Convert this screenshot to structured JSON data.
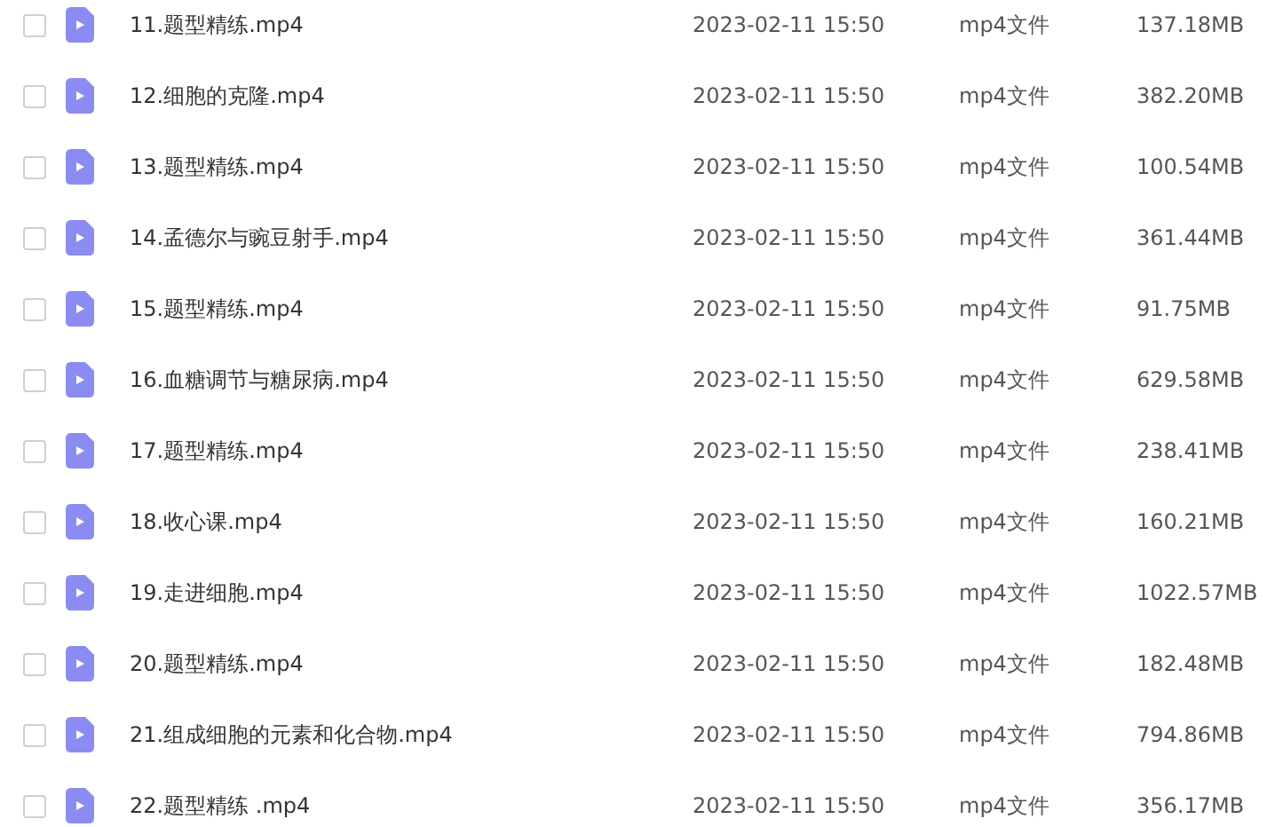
{
  "files": [
    {
      "name": "11.题型精练.mp4",
      "date": "2023-02-11 15:50",
      "type": "mp4文件",
      "size": "137.18MB",
      "checked": false
    },
    {
      "name": "12.细胞的克隆.mp4",
      "date": "2023-02-11 15:50",
      "type": "mp4文件",
      "size": "382.20MB",
      "checked": false
    },
    {
      "name": "13.题型精练.mp4",
      "date": "2023-02-11 15:50",
      "type": "mp4文件",
      "size": "100.54MB",
      "checked": false
    },
    {
      "name": "14.孟德尔与豌豆射手.mp4",
      "date": "2023-02-11 15:50",
      "type": "mp4文件",
      "size": "361.44MB",
      "checked": false
    },
    {
      "name": "15.题型精练.mp4",
      "date": "2023-02-11 15:50",
      "type": "mp4文件",
      "size": "91.75MB",
      "checked": false
    },
    {
      "name": "16.血糖调节与糖尿病.mp4",
      "date": "2023-02-11 15:50",
      "type": "mp4文件",
      "size": "629.58MB",
      "checked": false
    },
    {
      "name": "17.题型精练.mp4",
      "date": "2023-02-11 15:50",
      "type": "mp4文件",
      "size": "238.41MB",
      "checked": false
    },
    {
      "name": "18.收心课.mp4",
      "date": "2023-02-11 15:50",
      "type": "mp4文件",
      "size": "160.21MB",
      "checked": false
    },
    {
      "name": "19.走进细胞.mp4",
      "date": "2023-02-11 15:50",
      "type": "mp4文件",
      "size": "1022.57MB",
      "checked": false
    },
    {
      "name": "20.题型精练.mp4",
      "date": "2023-02-11 15:50",
      "type": "mp4文件",
      "size": "182.48MB",
      "checked": false
    },
    {
      "name": "21.组成细胞的元素和化合物.mp4",
      "date": "2023-02-11 15:50",
      "type": "mp4文件",
      "size": "794.86MB",
      "checked": false
    },
    {
      "name": "22.题型精练 .mp4",
      "date": "2023-02-11 15:50",
      "type": "mp4文件",
      "size": "356.17MB",
      "checked": false
    }
  ]
}
